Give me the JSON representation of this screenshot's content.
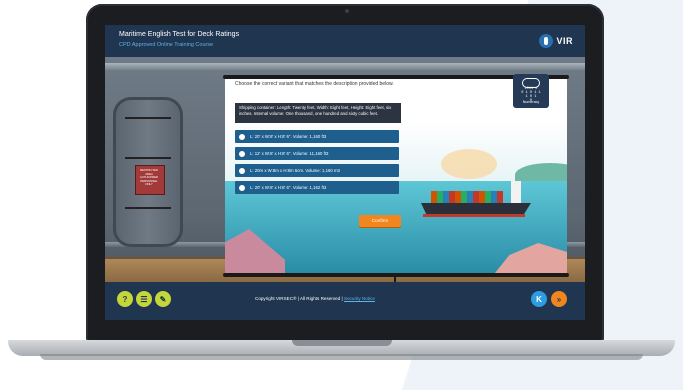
{
  "header": {
    "title": "Maritime English Test for Deck Ratings",
    "subtitle": "CPD Approved Online Training Course",
    "logo_text": "VIR"
  },
  "question": {
    "prompt": "Choose the correct variant that matches the description provided below.",
    "description": "Shipping container: Length: Twenty feet, Width: Eight feet, Height: Eight feet, six inches. Internal volume: One thousand, one hundred and sixty cubic feet.",
    "options": [
      {
        "label": "L: 20' x W:8' x H:8' 6\". Volume: 1,160 ft3"
      },
      {
        "label": "L: 12' x W:8' x H:8' 6\". Volume: 11,160 ft3"
      },
      {
        "label": "L: 20m x W:8m x H:8m 6cm. Volume: 1,160 m3"
      },
      {
        "label": "L: 20' x W:8' x H:8' 6\". Volume: 1,162 ft3"
      }
    ],
    "confirm_label": "Confirm"
  },
  "badge": {
    "bits": "1011 0\n0 1 0 1 1\n1 0 1\n0",
    "label": "Numeracy",
    "icon": "cloud-icon"
  },
  "door_sign": "RESTRICTED AREA AUTHORIZED PERSONNEL ONLY",
  "footer": {
    "copyright": "Copyright VIRSEC® | All Rights Reserved | ",
    "security_link": "Security Notice",
    "help_icon": "?",
    "list_icon": "☰",
    "edit_icon": "✎",
    "prev_icon": "K",
    "next_icon": "»"
  },
  "colors": {
    "header_bg": "#1f3550",
    "accent_blue": "#5fb3e8",
    "option_bg": "#1e5f8e",
    "confirm_bg": "#f0861d",
    "footer_green": "#c5d63a"
  }
}
